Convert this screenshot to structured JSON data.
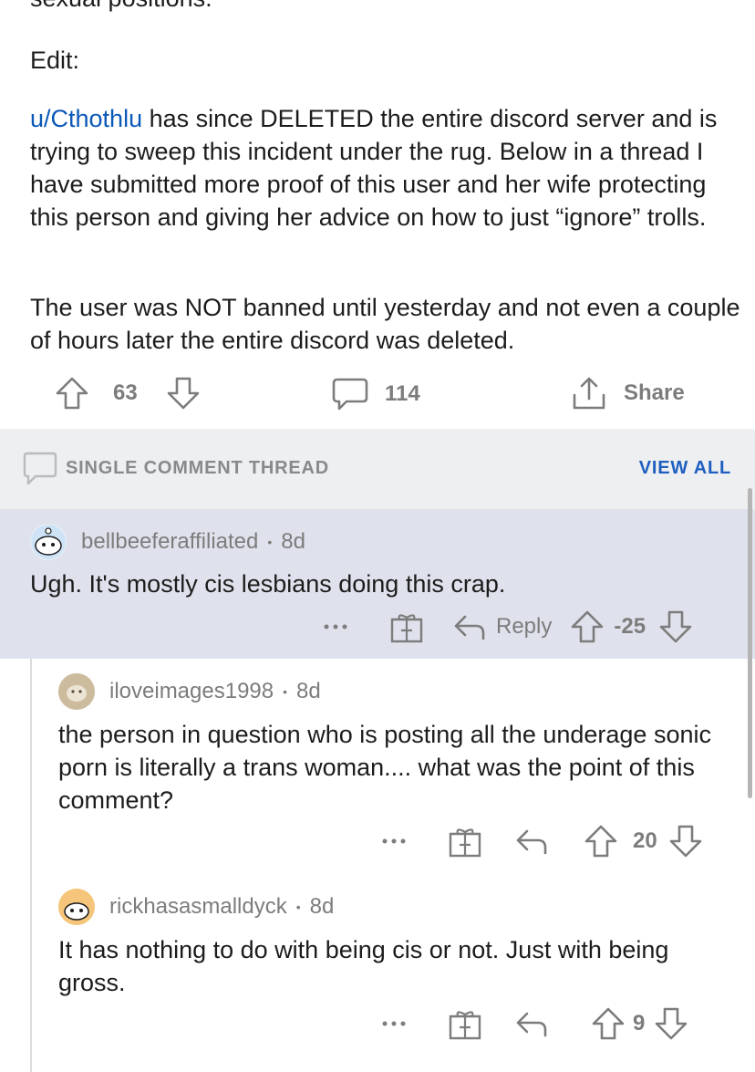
{
  "post": {
    "cut_line": "sexual positions.",
    "edit_label": "Edit:",
    "user_link": "u/Cthothlu",
    "para1_rest": " has since DELETED the entire discord server and is trying to sweep this incident under the rug. Below in a thread I have submitted more proof of this user and her wife protecting this person and giving her advice on how to just “ignore” trolls.",
    "para2": "The user was NOT banned until yesterday and not even a couple of hours later the entire discord was deleted.",
    "vote_count": "63",
    "comment_count": "114",
    "share_label": "Share"
  },
  "thread_header": {
    "title": "SINGLE COMMENT THREAD",
    "view_all": "VIEW ALL"
  },
  "comments": [
    {
      "username": "bellbeeferaffiliated",
      "age": "8d",
      "text": "Ugh. It's mostly cis lesbians doing this crap.",
      "reply_label": "Reply",
      "votes": "-25"
    },
    {
      "username": "iloveimages1998",
      "age": "8d",
      "text": "the person in question who is posting all the underage sonic porn is literally a trans woman.... what was the point of this comment?",
      "votes": "20"
    },
    {
      "username": "rickhasasmalldyck",
      "age": "8d",
      "text": "It has nothing to do with being cis or not. Just with being gross.",
      "votes": "9"
    }
  ],
  "icons": {
    "upvote": "arrow-up-outline-icon",
    "downvote": "arrow-down-outline-icon",
    "comment": "speech-bubble-icon",
    "share": "share-upload-icon",
    "more": "ellipsis-icon",
    "award": "gift-box-icon",
    "reply": "reply-arrow-icon"
  },
  "colors": {
    "link": "#0a58b8",
    "view_all": "#1f5fbf",
    "thread_header_bg": "#edeff1",
    "highlight_bg": "#dfe2ec",
    "muted": "#7c7c7c"
  }
}
